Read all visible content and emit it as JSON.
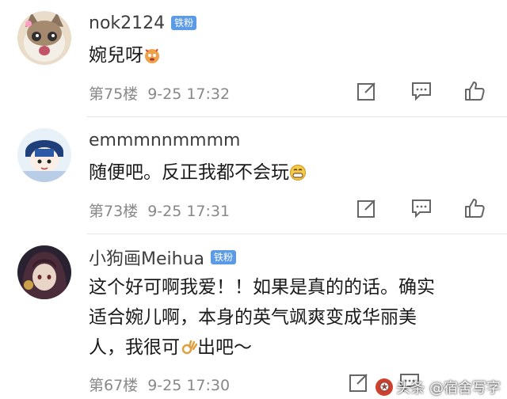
{
  "comments": [
    {
      "username": "nok2124",
      "badge": "铁粉",
      "text": "婉兒呀",
      "emoji": "sparkle-face-emoji",
      "floor": "第75楼",
      "time": "9-25 17:32"
    },
    {
      "username": "emmmnnmmmm",
      "badge": "",
      "text": "随便吧。反正我都不会玩",
      "emoji": "grinning-face-emoji",
      "floor": "第73楼",
      "time": "9-25 17:31"
    },
    {
      "username": "小狗画Meihua",
      "badge": "铁粉",
      "text_line1": "这个好可啊我爱！！如果是真的的话。确实",
      "text_line2": "适合婉儿啊，本身的英气飒爽变成华丽美",
      "text_line3a": "人，我很可",
      "text_line3b": "出吧～",
      "emoji": "ok-hand-emoji",
      "floor": "第67楼",
      "time": "9-25 17:30"
    }
  ],
  "actions": {
    "edit": "edit-icon",
    "reply": "comment-icon",
    "like": "thumbs-up-icon"
  },
  "watermark": "头条 @宿舍写字"
}
